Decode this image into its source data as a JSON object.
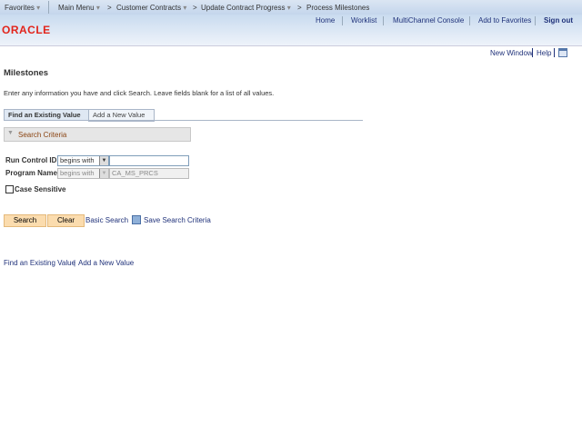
{
  "nav": {
    "favorites": "Favorites",
    "main_menu": "Main Menu",
    "crumb1": "Customer Contracts",
    "crumb2": "Update Contract Progress",
    "crumb3": "Process Milestones",
    "arrow": ">",
    "caret": "▾"
  },
  "header": {
    "logo": "ORACLE",
    "links": [
      "Home",
      "Worklist",
      "MultiChannel Console",
      "Add to Favorites"
    ],
    "sign_out": "Sign out"
  },
  "util": {
    "new_window": "New Window",
    "help": "Help"
  },
  "page": {
    "title": "Milestones",
    "instructions": "Enter any information you have and click Search. Leave fields blank for a list of all values."
  },
  "tabs": [
    "Find an Existing Value",
    "Add a New Value"
  ],
  "search_criteria": {
    "label": "Search Criteria",
    "fields": [
      {
        "label": "Run Control ID:",
        "operator": "begins with",
        "value": ""
      },
      {
        "label": "Program Name:",
        "operator": "begins with",
        "value": "CA_MS_PRCS"
      }
    ],
    "case_sensitive": "Case Sensitive"
  },
  "buttons": {
    "search": "Search",
    "clear": "Clear",
    "basic_search": "Basic Search",
    "save_criteria": "Save Search Criteria"
  },
  "footer": {
    "find": "Find an Existing Value",
    "add": "Add a New Value",
    "sep": "|"
  }
}
